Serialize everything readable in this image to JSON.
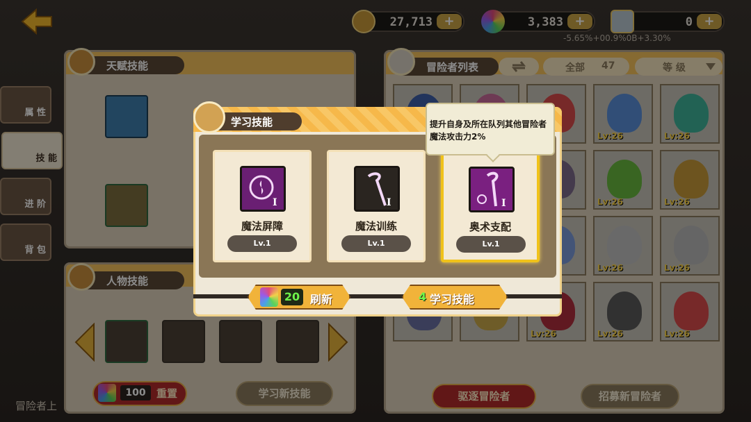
{
  "topbar": {
    "gold": "27,713",
    "gems": "3,383",
    "tickets": "0",
    "plus": "+",
    "ticket_subtext": "-5.65%+00.9%0B+3.30%"
  },
  "side_tabs": [
    {
      "label": "属 性"
    },
    {
      "label": "技 能"
    },
    {
      "label": "进 阶"
    },
    {
      "label": "背 包"
    }
  ],
  "talent_panel": {
    "title": "天赋技能"
  },
  "character_panel": {
    "title": "人物技能",
    "reset_cost": "100",
    "reset_label": "重置",
    "learn_new_label": "学习新技能"
  },
  "adventurer_panel": {
    "title": "冒险者列表",
    "filter_all": "全部",
    "count": "47",
    "sort_label": "等 级",
    "levels": [
      "Lv:26",
      "Lv:26",
      "Lv:26",
      "Lv:26",
      "Lv:26",
      "Lv:26",
      "Lv:26",
      "Lv:26",
      "Lv:26",
      "Lv:26",
      "Lv:26",
      "Lv:26",
      "Lv:26",
      "Lv:26",
      "Lv:26"
    ],
    "dismiss_label": "驱逐冒险者",
    "recruit_label": "招募新冒险者"
  },
  "bottom_left_text": "冒险者上",
  "modal": {
    "title": "学习技能",
    "skills": [
      {
        "name": "魔法屏障",
        "level": "Lv.1",
        "icon": "magic-shield-icon"
      },
      {
        "name": "魔法训练",
        "level": "Lv.1",
        "icon": "staff-icon"
      },
      {
        "name": "奥术支配",
        "level": "Lv.1",
        "icon": "arcane-staff-icon"
      }
    ],
    "refresh_cost": "20",
    "refresh_label": "刷新",
    "learn_count": "4",
    "learn_label": "学习技能"
  },
  "tooltip": {
    "text": "提升自身及所在队列其他冒险者魔法攻击力2%"
  },
  "colors": {
    "accent": "#f1b33a",
    "selected": "#f0c21a",
    "count_green": "#6ef34a"
  }
}
